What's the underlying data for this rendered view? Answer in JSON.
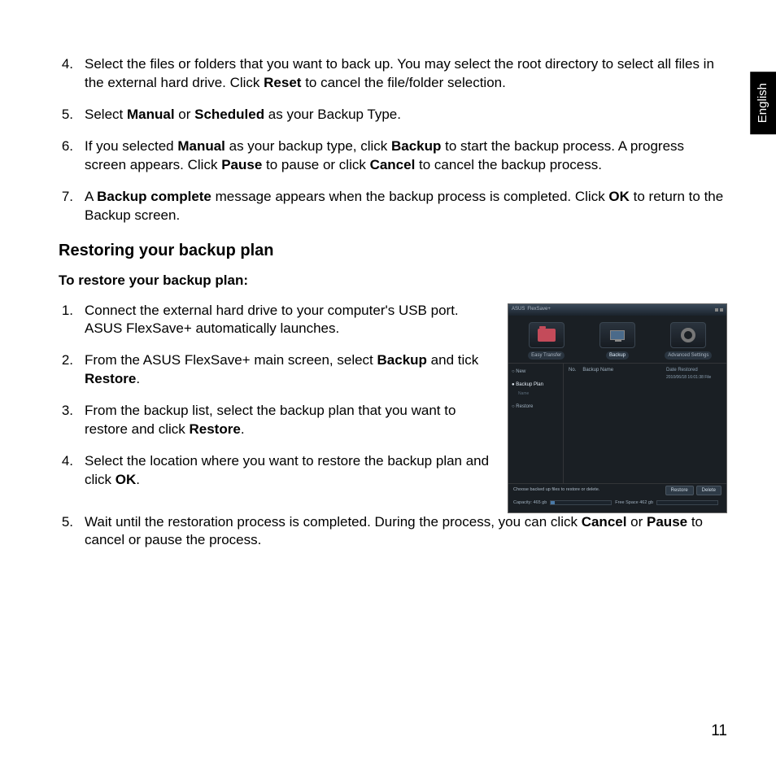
{
  "language_tab": "English",
  "page_number": "11",
  "list_top": [
    {
      "num": "4.",
      "html": "Select the files or folders that you want to back up.  You may select the root directory to select all files in the external hard drive. Click <b>Reset</b> to cancel the file/folder selection."
    },
    {
      "num": "5.",
      "html": "Select <b>Manual</b> or <b>Scheduled</b> as your Backup Type."
    },
    {
      "num": "6.",
      "html": "If you selected <b>Manual</b> as your backup type, click <b>Backup</b> to start the backup process.  A progress screen appears. Click <b>Pause</b> to pause or click <b>Cancel</b> to cancel the backup process."
    },
    {
      "num": "7.",
      "html": "A <b>Backup complete</b> message appears when the backup process is completed. Click <b>OK</b> to return to the Backup screen."
    }
  ],
  "heading_restore": "Restoring your backup plan",
  "sub_restore": "To  restore your backup plan:",
  "list_restore": [
    {
      "num": "1.",
      "html": "Connect the external hard drive to your computer's USB port. ASUS FlexSave+ automatically launches."
    },
    {
      "num": "2.",
      "html": "From the ASUS FlexSave+ main screen, select <b>Backup</b> and tick <b>Restore</b>."
    },
    {
      "num": "3.",
      "html": "From the backup list, select the backup plan that you want to restore and click <b>Restore</b>."
    },
    {
      "num": "4.",
      "html": "Select the location where you want to restore the backup plan and click <b>OK</b>."
    },
    {
      "num": "5.",
      "html": "Wait until the restoration process is completed. During the process, you can click <b>Cancel</b> or <b>Pause</b> to cancel or pause the process."
    }
  ],
  "screenshot": {
    "title_brand": "ASUS",
    "title_app": "FlexSave+",
    "tabs": [
      "Easy Transfer",
      "Backup",
      "Advanced Settings"
    ],
    "left_opts": [
      "New",
      "Backup Plan",
      "Restore"
    ],
    "left_sub": "Name",
    "center_hdr": [
      "No.",
      "Backup Name"
    ],
    "right_hdr": "Date Restored",
    "right_date": "2010/06/18  16:01:38  File",
    "note": "Choose backed up files to restore or delete.",
    "btn1": "Restore",
    "btn2": "Delete",
    "cap_left_lbl": "Capacity: 465 gb",
    "cap_right_lbl": "Free Space 462 gb"
  }
}
